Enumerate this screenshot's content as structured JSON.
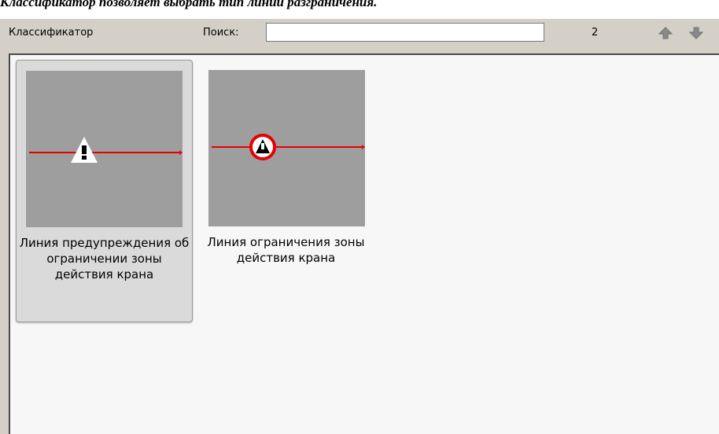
{
  "caption": "Классификатор позволяет выбрать тип линии разграничения.",
  "toolbar": {
    "title": "Классификатор",
    "search_label": "Поиск:",
    "search_value": "",
    "count": "2"
  },
  "items": [
    {
      "label": "Линия предупреждения об ограничении зоны действия крана",
      "selected": true,
      "icon": "warning-triangle-icon"
    },
    {
      "label": "Линия ограничения зоны действия крана",
      "selected": false,
      "icon": "prohibition-circle-icon"
    }
  ],
  "colors": {
    "line": "#e60000",
    "thumb_bg": "#9e9e9e",
    "panel_bg": "#d4d0c8",
    "list_bg": "#f7f7f7"
  }
}
